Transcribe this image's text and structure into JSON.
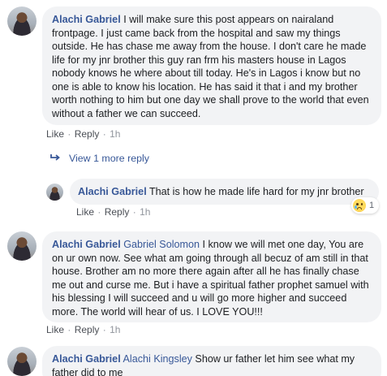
{
  "comments": [
    {
      "author": "Alachi Gabriel",
      "mention": "",
      "text": "I will make sure this post appears on nairaland frontpage. I just came back from the hospital and saw my things outside. He has chase me away from the house. I don't care he made life for my jnr brother this guy ran frm his masters house in Lagos nobody knows he where about till today. He's in Lagos i know but no one is able to know his location. He has said it that i and my brother worth nothing to him but one day we shall prove to the world that even without a father we can succeed.",
      "like": "Like",
      "reply": "Reply",
      "time": "1h"
    },
    {
      "author": "Alachi Gabriel",
      "mention": "Gabriel Solomon",
      "text": "I know we will met one day, You are on ur own now. See what am going through all becuz of am still in that house. Brother am no more there again after all he has finally chase me out and curse me. But i have a spiritual father prophet samuel with his blessing I will succeed and u will go more higher and succeed more. The world will hear of us. I LOVE YOU!!!",
      "like": "Like",
      "reply": "Reply",
      "time": "1h"
    },
    {
      "author": "Alachi Gabriel",
      "mention": "Alachi Kingsley",
      "text": "Show ur father let him see what my father did to me"
    }
  ],
  "view_more": "View 1 more reply",
  "reply": {
    "author": "Alachi Gabriel",
    "text": "That is how he made life hard for my jnr brother",
    "like": "Like",
    "reply": "Reply",
    "time": "1h",
    "reaction_count": "1",
    "reaction_icon": "sad-emoji-icon"
  },
  "separator": "·"
}
